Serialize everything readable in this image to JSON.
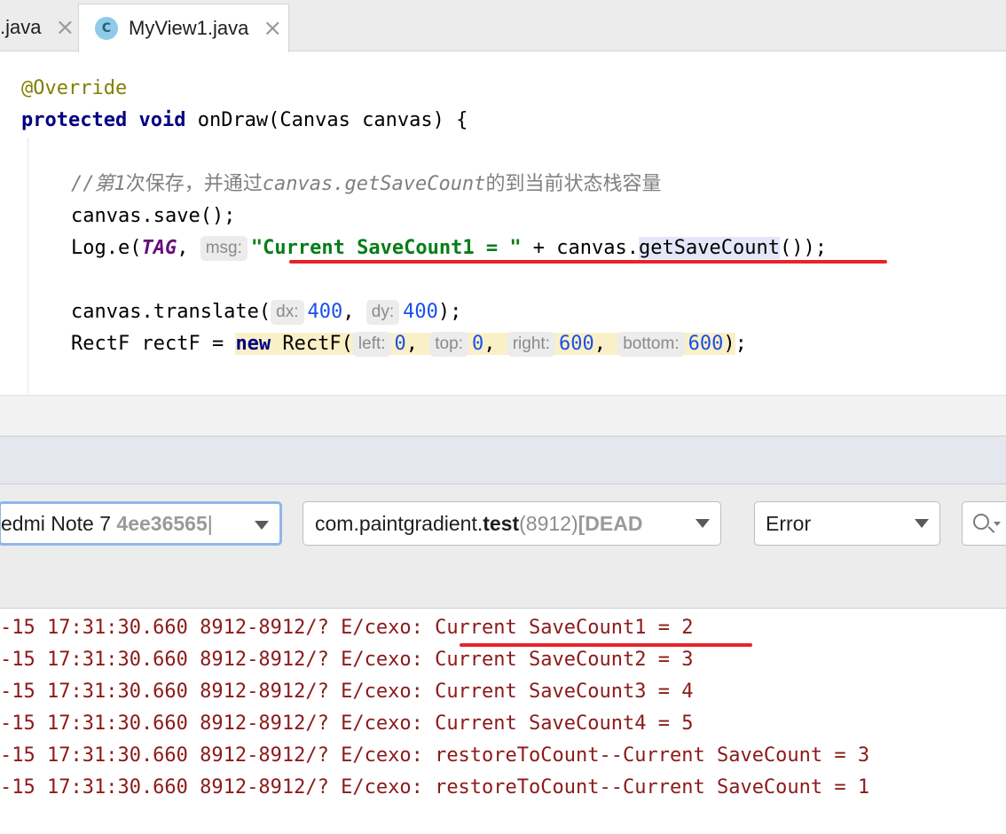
{
  "tabs": [
    {
      "label": ".java",
      "active": false
    },
    {
      "label": "MyView1.java",
      "active": true,
      "icon": "C"
    }
  ],
  "code": {
    "annotation": "@Override",
    "sig_kw1": "protected",
    "sig_kw2": "void",
    "sig_rest": " onDraw(Canvas canvas) {",
    "comment_a": "//第",
    "comment_b": "1",
    "comment_c": "次保存，并通过",
    "comment_d": "canvas.getSaveCount",
    "comment_e": "的到当前状态栈容量",
    "save": "canvas.save();",
    "log_pre": "Log.e(",
    "log_tag": "TAG",
    "log_comma": ", ",
    "log_hint": "msg:",
    "log_str": "\"Current SaveCount1 = \"",
    "log_mid": " + canvas.",
    "log_method": "getSaveCount",
    "log_end": "());",
    "tr_pre": "canvas.translate(",
    "tr_hint_dx": "dx:",
    "tr_dx": "400",
    "tr_comma": ", ",
    "tr_hint_dy": "dy:",
    "tr_dy": "400",
    "tr_end": ");",
    "rect_pre": "RectF rectF = ",
    "rect_new": "new",
    "rect_cls": " RectF(",
    "rect_hint_left": "left:",
    "rect_left": "0",
    "rect_hint_top": "top:",
    "rect_top": "0",
    "rect_hint_right": "right:",
    "rect_right": "600",
    "rect_hint_bottom": "bottom:",
    "rect_bottom": "600",
    "rect_close": ")",
    "rect_end": ";",
    "comma": ", "
  },
  "logcat": {
    "device_name": "edmi Note 7",
    "device_serial": "4ee36565",
    "device_sep": " |",
    "process_plain": "com.paintgradient.",
    "process_bold": "test",
    "process_pid": " (8912)",
    "process_state": " [DEAD",
    "level": "Error",
    "search_icon": "search-icon",
    "lines": [
      "-15 17:31:30.660 8912-8912/? E/cexo: Current SaveCount1 = 2",
      "-15 17:31:30.660 8912-8912/? E/cexo: Current SaveCount2 = 3",
      "-15 17:31:30.660 8912-8912/? E/cexo: Current SaveCount3 = 4",
      "-15 17:31:30.660 8912-8912/? E/cexo: Current SaveCount4 = 5",
      "-15 17:31:30.660 8912-8912/? E/cexo: restoreToCount--Current SaveCount = 3",
      "-15 17:31:30.660 8912-8912/? E/cexo: restoreToCount--Current SaveCount = 1"
    ]
  },
  "colors": {
    "error_text": "#8b1a1a",
    "underline": "#e8232b",
    "keyword": "#000080",
    "string": "#067d17",
    "number": "#1750eb"
  }
}
